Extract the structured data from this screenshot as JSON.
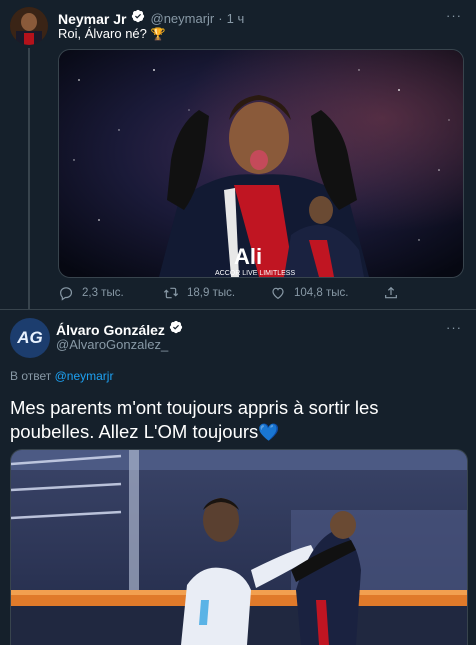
{
  "tweet1": {
    "display_name": "Neymar Jr",
    "handle": "@neymarjr",
    "separator": "·",
    "time": "1 ч",
    "text": "Roi, Álvaro né?",
    "emoji": "🏆",
    "more": "···",
    "image_caption_1": "Ali",
    "image_caption_2": "ACCOR LIVE LIMITLESS",
    "actions": {
      "reply_count": "2,3 тыс.",
      "retweet_count": "18,9 тыс.",
      "like_count": "104,8 тыс."
    }
  },
  "tweet2": {
    "display_name": "Álvaro González",
    "handle": "@AlvaroGonzalez_",
    "avatar_text": "AG",
    "more": "···",
    "reply_prefix": "В ответ",
    "reply_to": "@neymarjr",
    "text_line1": "Mes parents m'ont toujours appris à sortir les",
    "text_line2": "poubelles. Allez L'OM toujours",
    "emoji": "💙"
  },
  "colors": {
    "background": "#15202b",
    "muted": "#8899a6",
    "accent": "#1da1f2",
    "divider": "#38444d"
  }
}
